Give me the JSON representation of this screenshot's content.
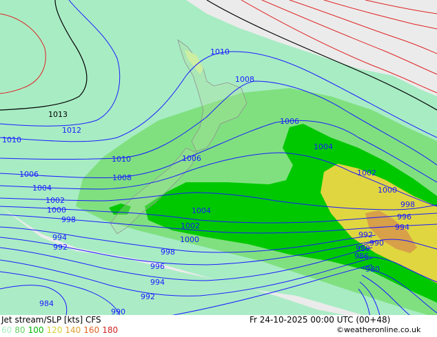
{
  "title": "Jet stream/SLP [kts] CFS",
  "datetime": "Fr 24-10-2025 00:00 UTC (00+48)",
  "credit": "©weatheronline.co.uk",
  "legend": [
    {
      "value": "60",
      "color": "#a8f0c0"
    },
    {
      "value": "80",
      "color": "#60d060"
    },
    {
      "value": "100",
      "color": "#00b800"
    },
    {
      "value": "120",
      "color": "#d8d030"
    },
    {
      "value": "140",
      "color": "#e0a030"
    },
    {
      "value": "160",
      "color": "#e06020"
    },
    {
      "value": "180",
      "color": "#d02020"
    }
  ],
  "colors": {
    "background": "#ebebeb",
    "jet_60": "#a8ecc4",
    "jet_80": "#80e080",
    "jet_100": "#00c800",
    "jet_120": "#e0d640",
    "jet_140": "#d8a048",
    "isobar_blue": "#1a1aff",
    "isobar_black": "#000000",
    "isobar_red": "#e02020",
    "land": "#b0e0a0",
    "coast": "#909090"
  },
  "isobar_labels": [
    {
      "text": "1010"
    },
    {
      "text": "1008"
    },
    {
      "text": "1013"
    },
    {
      "text": "1012"
    },
    {
      "text": "1010"
    },
    {
      "text": "1006"
    },
    {
      "text": "1004"
    },
    {
      "text": "1010"
    },
    {
      "text": "1006"
    },
    {
      "text": "1006"
    },
    {
      "text": "1004"
    },
    {
      "text": "1002"
    },
    {
      "text": "1000"
    },
    {
      "text": "998"
    },
    {
      "text": "994"
    },
    {
      "text": "992"
    },
    {
      "text": "1008"
    },
    {
      "text": "1004"
    },
    {
      "text": "1002"
    },
    {
      "text": "1000"
    },
    {
      "text": "998"
    },
    {
      "text": "996"
    },
    {
      "text": "994"
    },
    {
      "text": "992"
    },
    {
      "text": "990"
    },
    {
      "text": "984"
    },
    {
      "text": "1002"
    },
    {
      "text": "1000"
    },
    {
      "text": "998"
    },
    {
      "text": "996"
    },
    {
      "text": "994"
    },
    {
      "text": "992"
    },
    {
      "text": "990"
    },
    {
      "text": "988"
    },
    {
      "text": "986"
    },
    {
      "text": "980"
    }
  ]
}
